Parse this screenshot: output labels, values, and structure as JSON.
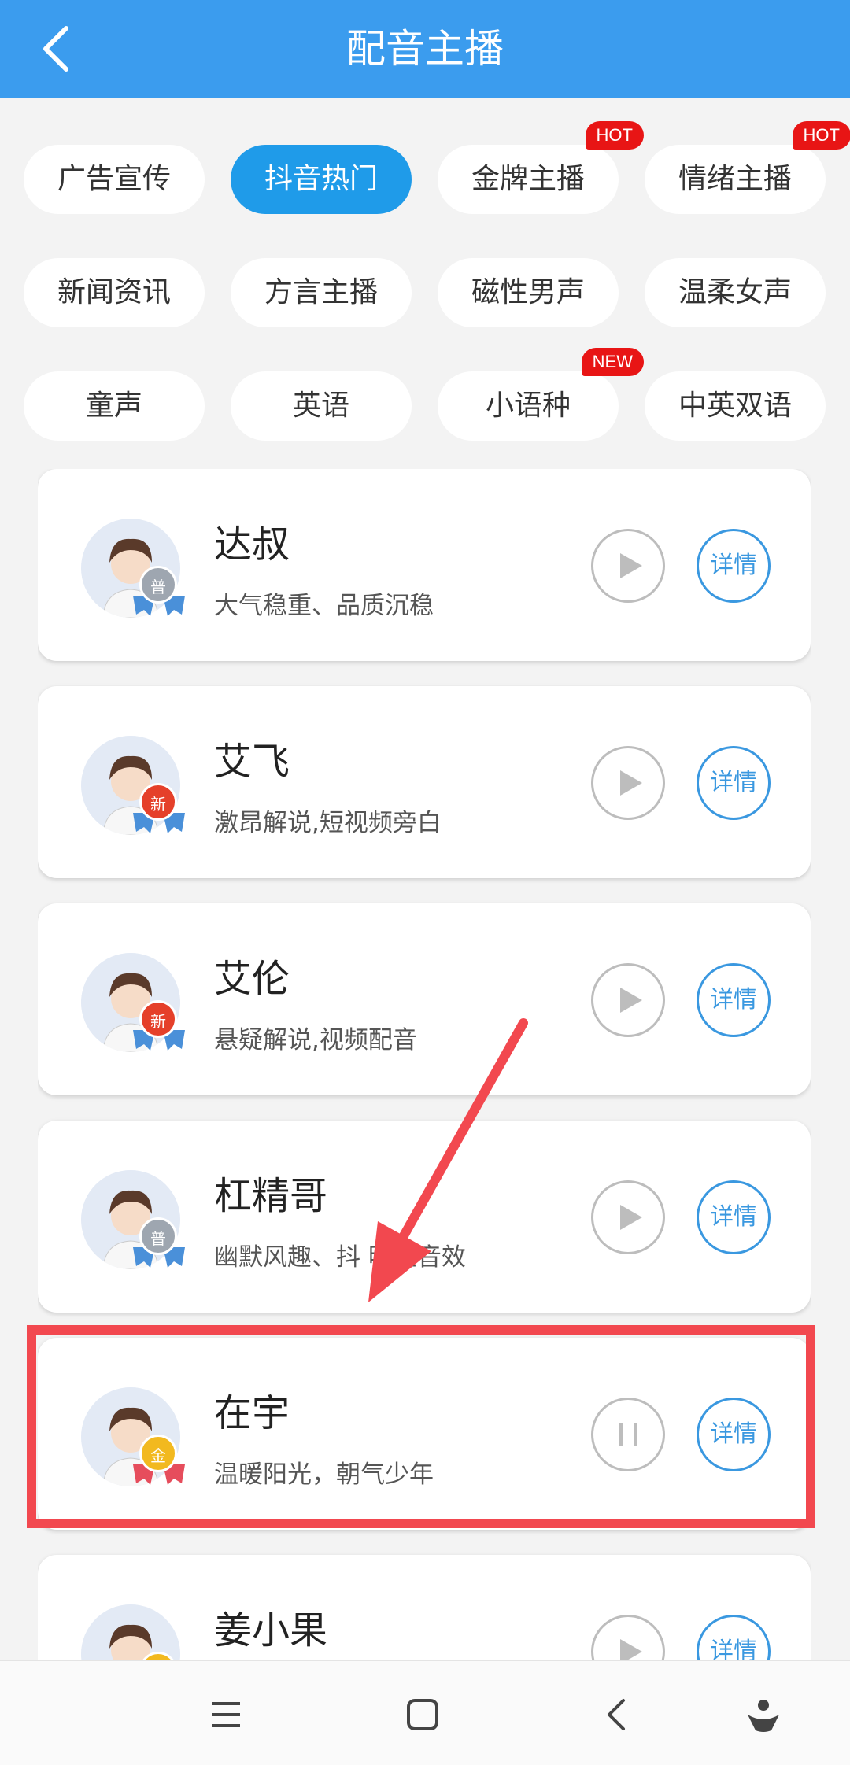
{
  "header": {
    "title": "配音主播"
  },
  "chips": [
    {
      "label": "广告宣传",
      "active": false,
      "badge": ""
    },
    {
      "label": "抖音热门",
      "active": true,
      "badge": ""
    },
    {
      "label": "金牌主播",
      "active": false,
      "badge": "HOT"
    },
    {
      "label": "情绪主播",
      "active": false,
      "badge": "HOT"
    },
    {
      "label": "新闻资讯",
      "active": false,
      "badge": ""
    },
    {
      "label": "方言主播",
      "active": false,
      "badge": ""
    },
    {
      "label": "磁性男声",
      "active": false,
      "badge": ""
    },
    {
      "label": "温柔女声",
      "active": false,
      "badge": ""
    },
    {
      "label": "童声",
      "active": false,
      "badge": ""
    },
    {
      "label": "英语",
      "active": false,
      "badge": ""
    },
    {
      "label": "小语种",
      "active": false,
      "badge": "NEW"
    },
    {
      "label": "中英双语",
      "active": false,
      "badge": ""
    }
  ],
  "anchors": [
    {
      "name": "达叔",
      "desc": "大气稳重、品质沉稳",
      "medal": "普",
      "medal_type": "silver",
      "playing": false,
      "detail_label": "详情"
    },
    {
      "name": "艾飞",
      "desc": "激昂解说,短视频旁白",
      "medal": "新",
      "medal_type": "new",
      "playing": false,
      "detail_label": "详情"
    },
    {
      "name": "艾伦",
      "desc": "悬疑解说,视频配音",
      "medal": "新",
      "medal_type": "new",
      "playing": false,
      "detail_label": "详情"
    },
    {
      "name": "杠精哥",
      "desc": "幽默风趣、抖  明星音效",
      "medal": "普",
      "medal_type": "silver",
      "playing": false,
      "detail_label": "详情"
    },
    {
      "name": "在宇",
      "desc": "温暖阳光，朝气少年",
      "medal": "金",
      "medal_type": "gold",
      "playing": true,
      "detail_label": "详情"
    },
    {
      "name": "姜小果",
      "desc": "",
      "medal": "金",
      "medal_type": "gold",
      "playing": false,
      "detail_label": "详情"
    }
  ],
  "colors": {
    "primary": "#3b9cee",
    "active_chip": "#1f9be9",
    "badge": "#e81515",
    "highlight": "#f2484f"
  },
  "nav": {
    "icons": [
      "menu-icon",
      "home-square-icon",
      "back-chevron-icon",
      "assistant-icon"
    ]
  }
}
